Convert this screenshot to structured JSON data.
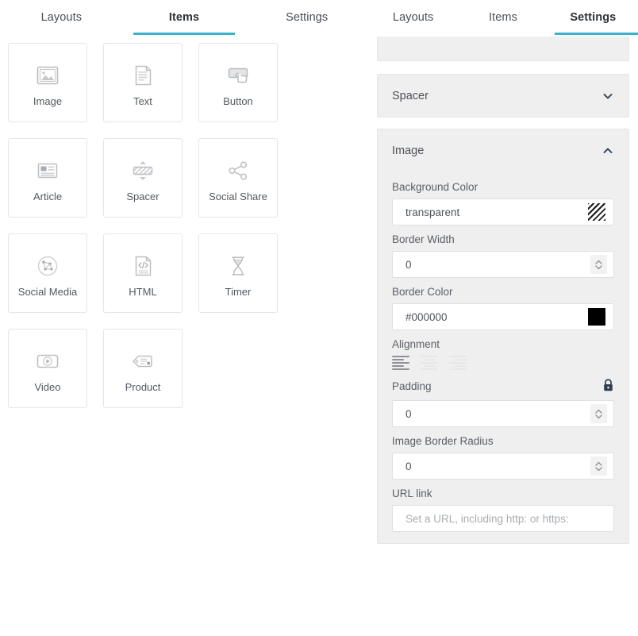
{
  "left_panel": {
    "tabs": [
      {
        "label": "Layouts",
        "active": false
      },
      {
        "label": "Items",
        "active": true
      },
      {
        "label": "Settings",
        "active": false
      }
    ],
    "items": [
      {
        "label": "Image",
        "icon": "image-icon"
      },
      {
        "label": "Text",
        "icon": "text-document-icon"
      },
      {
        "label": "Button",
        "icon": "button-click-icon"
      },
      {
        "label": "Article",
        "icon": "article-icon"
      },
      {
        "label": "Spacer",
        "icon": "spacer-icon"
      },
      {
        "label": "Social Share",
        "icon": "social-share-icon"
      },
      {
        "label": "Social Media",
        "icon": "social-media-network-icon"
      },
      {
        "label": "HTML",
        "icon": "html-code-icon"
      },
      {
        "label": "Timer",
        "icon": "hourglass-timer-icon"
      },
      {
        "label": "Video",
        "icon": "video-play-icon"
      },
      {
        "label": "Product",
        "icon": "product-tag-icon"
      }
    ]
  },
  "right_panel": {
    "tabs": [
      {
        "label": "Layouts",
        "active": false
      },
      {
        "label": "Items",
        "active": false
      },
      {
        "label": "Settings",
        "active": true
      }
    ],
    "sections": {
      "spacer": {
        "title": "Spacer",
        "expanded": false,
        "chevron": "chevron-down-icon"
      },
      "image": {
        "title": "Image",
        "expanded": true,
        "chevron": "chevron-up-icon"
      }
    },
    "fields": {
      "background_color": {
        "label": "Background Color",
        "value": "transparent",
        "swatch": "transparent-checker-swatch"
      },
      "border_width": {
        "label": "Border Width",
        "value": "0",
        "spinner": "stepper-updown-icon"
      },
      "border_color": {
        "label": "Border Color",
        "value": "#000000",
        "swatch_color": "#000000"
      },
      "alignment": {
        "label": "Alignment",
        "options": [
          "align-left-icon",
          "align-center-icon",
          "align-right-icon"
        ],
        "selected": "align-left-icon"
      },
      "padding": {
        "label": "Padding",
        "value": "0",
        "lock": "lock-closed-icon",
        "spinner": "stepper-updown-icon"
      },
      "image_border_radius": {
        "label": "Image Border Radius",
        "value": "0",
        "spinner": "stepper-updown-icon"
      },
      "url_link": {
        "label": "URL link",
        "value": "",
        "placeholder": "Set a URL, including http: or https:"
      }
    }
  },
  "colors": {
    "accent": "#3bb2cd",
    "panel_bg": "#efefef",
    "text": "#4c5158"
  }
}
